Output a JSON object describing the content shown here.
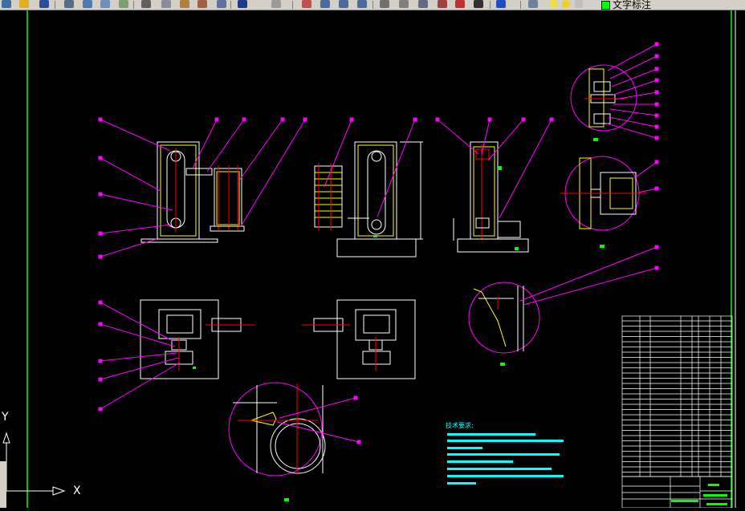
{
  "toolbar": {
    "layer_name": "文字标注",
    "layer_color": "#00ff00",
    "icons": [
      "new-icon",
      "open-icon",
      "save-icon",
      "plot-icon",
      "preview-icon",
      "publish-icon",
      "cut-icon",
      "copy-icon",
      "paste-icon",
      "match-icon",
      "undo-icon",
      "redo-icon",
      "pan-icon",
      "zoom-realtime-icon",
      "zoom-window-icon",
      "zoom-previous-icon",
      "properties-icon",
      "design-center-icon",
      "tool-palette-icon",
      "sheet-set-icon",
      "markup-icon",
      "calculator-icon",
      "help-icon",
      "layer-manager-icon",
      "light-bulb-icon",
      "sun-icon",
      "lock-icon"
    ]
  },
  "canvas": {
    "background": "#000000",
    "axis_x_label": "X",
    "axis_y_label": "Y",
    "tech_requirements_title": "技术要求:"
  },
  "colors": {
    "outline": "#ffffff",
    "frame": "#00ff00",
    "leader": "#ff00ff",
    "center": "#ff0000",
    "hatch": "#ffff00",
    "text": "#00ffff"
  }
}
